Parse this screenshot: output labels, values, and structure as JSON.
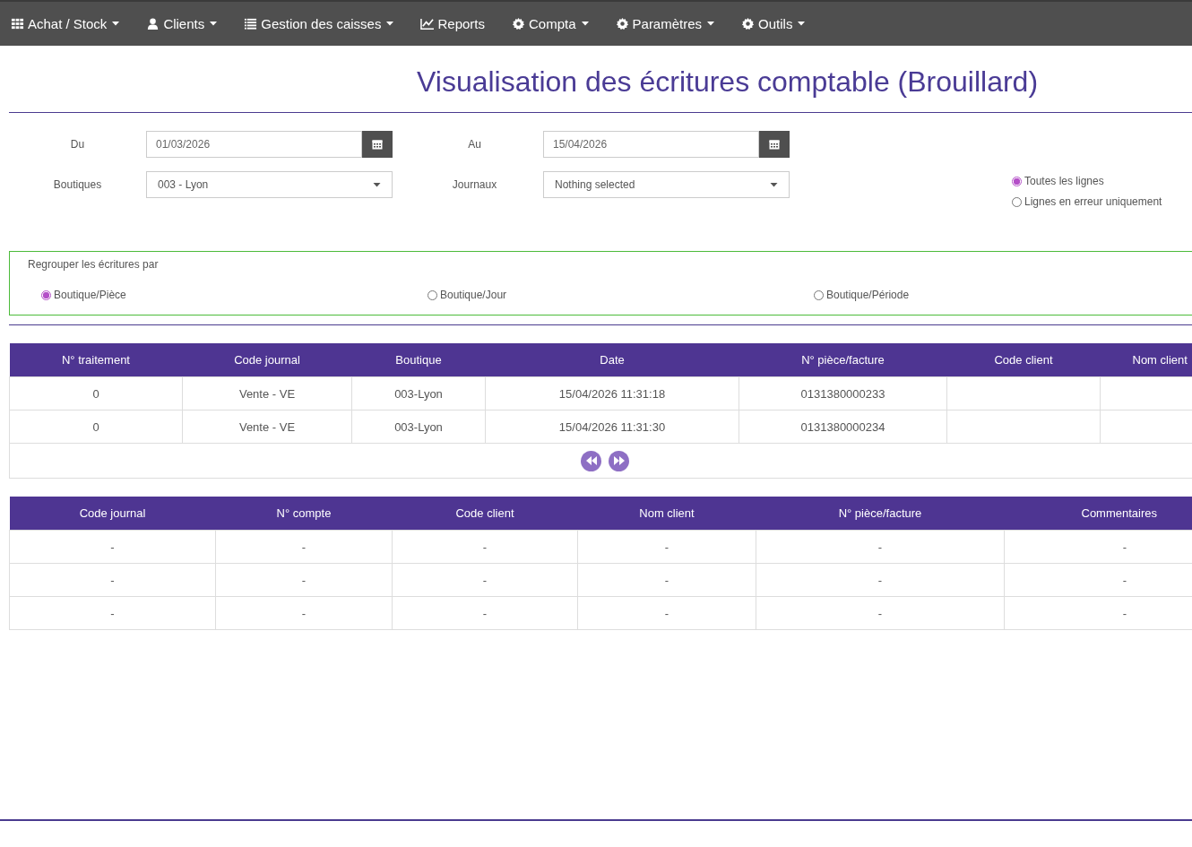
{
  "nav": [
    {
      "label": "Achat / Stock",
      "kind": "grid",
      "has_menu": true
    },
    {
      "label": "Clients",
      "kind": "user",
      "has_menu": true
    },
    {
      "label": "Gestion des caisses",
      "kind": "list",
      "has_menu": true
    },
    {
      "label": "Reports",
      "kind": "chart",
      "has_menu": false
    },
    {
      "label": "Compta",
      "kind": "gear",
      "has_menu": true
    },
    {
      "label": "Paramètres",
      "kind": "gear",
      "has_menu": true
    },
    {
      "label": "Outils",
      "kind": "gear",
      "has_menu": true
    }
  ],
  "title": "Visualisation des écritures comptable (Brouillard)",
  "filters": {
    "du": {
      "label": "Du",
      "value": "01/03/2026"
    },
    "au": {
      "label": "Au",
      "value": "15/04/2026"
    },
    "boutiques": {
      "label": "Boutiques",
      "value": "003 - Lyon"
    },
    "journaux": {
      "label": "Journaux",
      "value": "Nothing selected"
    }
  },
  "line_filter": [
    {
      "label": "Toutes les lignes",
      "selected": true
    },
    {
      "label": "Lignes en erreur uniquement",
      "selected": false
    }
  ],
  "grouping": {
    "label": "Regrouper les écritures par",
    "options": [
      {
        "label": "Boutique/Pièce",
        "selected": true
      },
      {
        "label": "Boutique/Jour",
        "selected": false
      },
      {
        "label": "Boutique/Période",
        "selected": false
      }
    ]
  },
  "table1": {
    "columns": [
      "N° traitement",
      "Code journal",
      "Boutique",
      "Date",
      "N° pièce/facture",
      "Code client",
      "Nom client"
    ],
    "rows": [
      [
        "0",
        "Vente - VE",
        "003-Lyon",
        "15/04/2026 11:31:18",
        "0131380000233",
        "",
        ""
      ],
      [
        "0",
        "Vente - VE",
        "003-Lyon",
        "15/04/2026 11:31:30",
        "0131380000234",
        "",
        ""
      ]
    ]
  },
  "table2": {
    "columns": [
      "Code journal",
      "N° compte",
      "Code client",
      "Nom client",
      "N° pièce/facture",
      "Commentaires"
    ],
    "rows": [
      [
        "-",
        "-",
        "-",
        "-",
        "-",
        "-"
      ],
      [
        "-",
        "-",
        "-",
        "-",
        "-",
        "-"
      ],
      [
        "-",
        "-",
        "-",
        "-",
        "-",
        "-"
      ]
    ]
  }
}
